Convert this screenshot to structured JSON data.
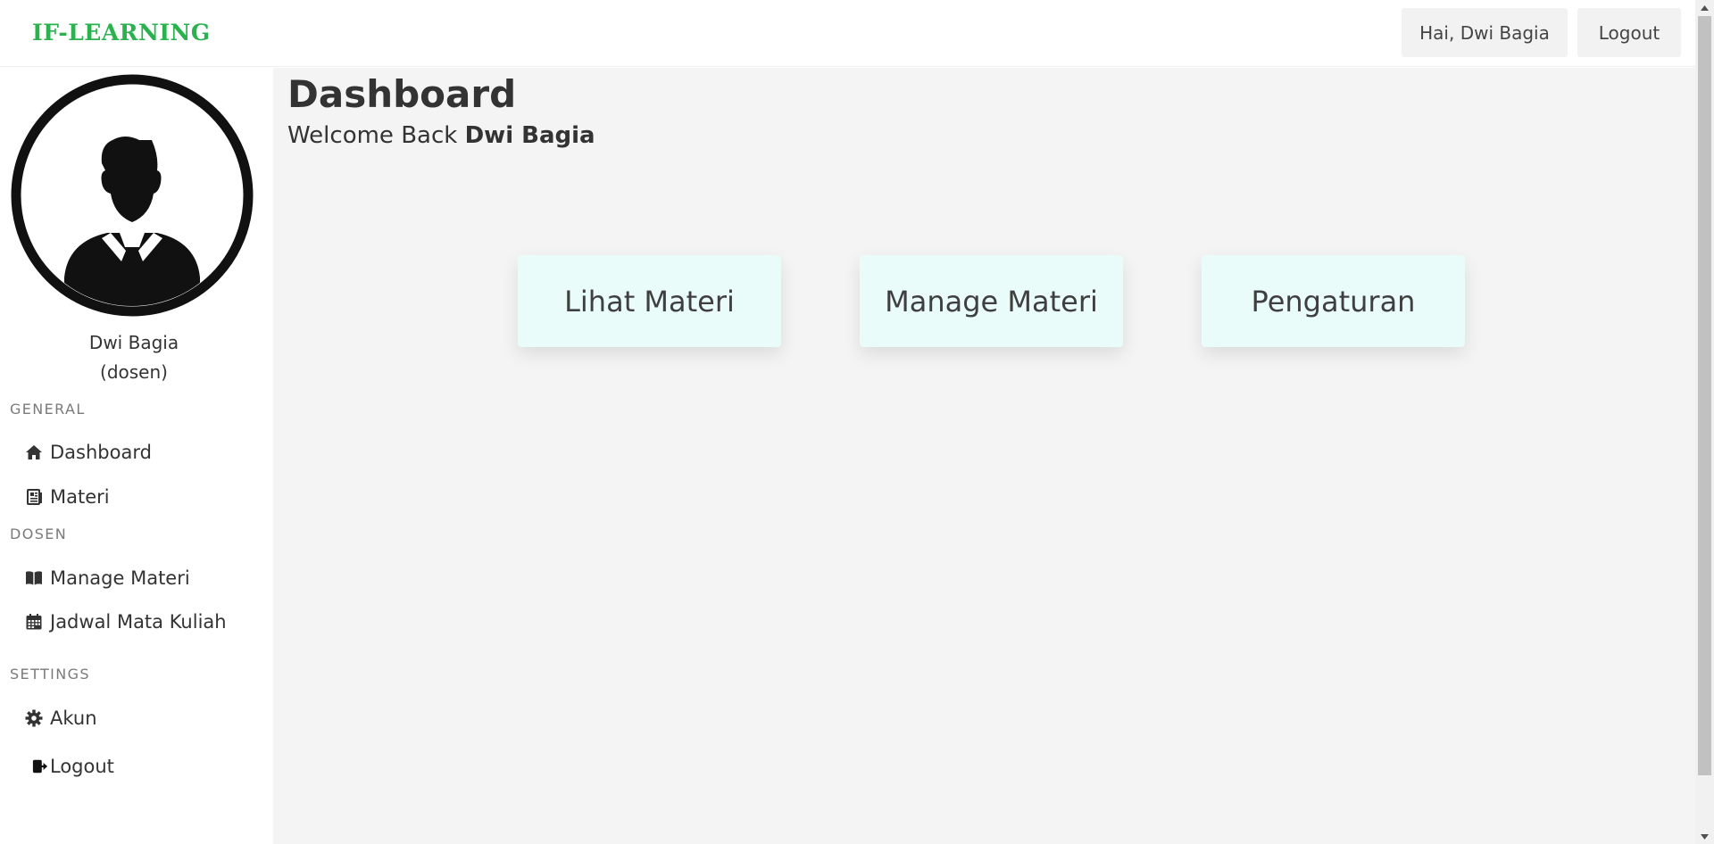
{
  "brand": "IF-LEARNING",
  "header": {
    "greeting": "Hai, Dwi Bagia",
    "logout": "Logout"
  },
  "user": {
    "name": "Dwi Bagia",
    "role": "(dosen)"
  },
  "sidebar": {
    "general_label": "GENERAL",
    "dosen_label": "DOSEN",
    "settings_label": "SETTINGS",
    "items": [
      {
        "label": "Dashboard",
        "icon": "home-icon"
      },
      {
        "label": "Materi",
        "icon": "newspaper-icon"
      },
      {
        "label": "Manage Materi",
        "icon": "book-icon"
      },
      {
        "label": "Jadwal Mata Kuliah",
        "icon": "calendar-icon"
      },
      {
        "label": "Akun",
        "icon": "gear-icon"
      },
      {
        "label": "Logout",
        "icon": "sign-out-icon"
      }
    ]
  },
  "main": {
    "title": "Dashboard",
    "welcome_prefix": "Welcome Back",
    "welcome_name": "Dwi Bagia",
    "cards": [
      {
        "label": "Lihat Materi"
      },
      {
        "label": "Manage Materi"
      },
      {
        "label": "Pengaturan"
      }
    ]
  },
  "colors": {
    "brand": "#2ab24f",
    "card_bg": "#e9fcfa",
    "main_bg": "#f4f4f4"
  }
}
